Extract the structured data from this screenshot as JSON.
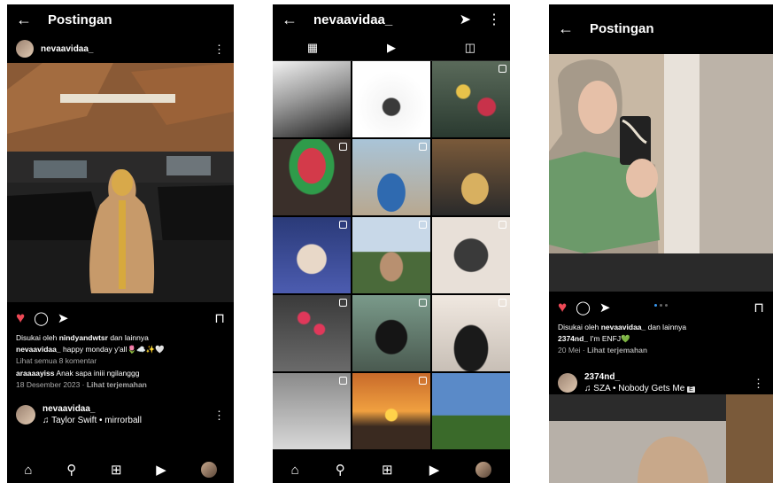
{
  "screen1": {
    "header_title": "Postingan",
    "username": "nevaavidaa_",
    "liked_by_text": "Disukai oleh",
    "liked_by_user": "nindyandwtsr",
    "liked_and_others": "dan lainnya",
    "caption_user": "nevaavidaa_",
    "caption_text": "happy monday y'all🌷☁️✨🤍",
    "view_comments": "Lihat semua 8 komentar",
    "comment_user": "araaaayiss",
    "comment_text": "Anak sapa iniii ngilanggg",
    "date": "18 Desember 2023",
    "translate": "Lihat terjemahan",
    "next_username": "nevaavidaa_",
    "next_music": "Taylor Swift • mirrorball"
  },
  "screen2": {
    "profile_username": "nevaavidaa_"
  },
  "screen3": {
    "header_title": "Postingan",
    "liked_by_text": "Disukai oleh",
    "liked_by_user": "nevaavidaa_",
    "liked_and_others": "dan lainnya",
    "caption_user": "2374nd_",
    "caption_text": "I'm ENFJ💚",
    "date": "20 Mei",
    "translate": "Lihat terjemahan",
    "next_username": "2374nd_",
    "next_music": "SZA • Nobody Gets Me",
    "explicit_badge": "E"
  },
  "colors": {
    "like_red": "#ed4956",
    "carousel_blue": "#3897f0",
    "background": "#000000"
  }
}
